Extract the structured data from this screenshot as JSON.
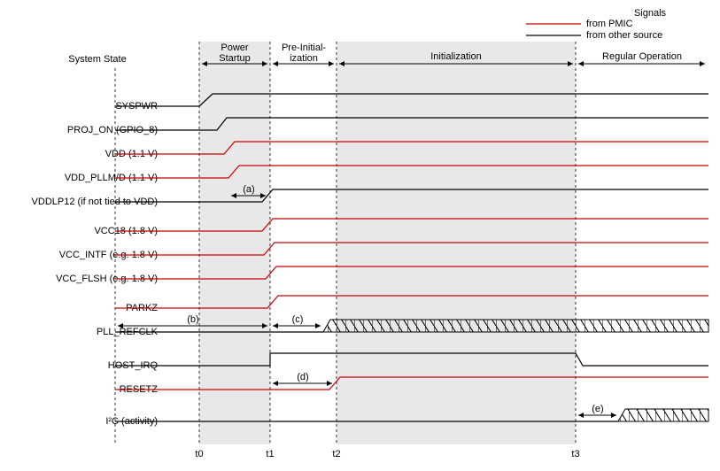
{
  "legend": {
    "title": "Signals",
    "items": [
      {
        "label": "from PMIC",
        "color": "#cc0000"
      },
      {
        "label": "from other source",
        "color": "#000000"
      }
    ]
  },
  "header": {
    "system_state": "System State"
  },
  "phases": {
    "power_startup_l1": "Power",
    "power_startup_l2": "Startup",
    "pre_init_l1": "Pre-Initial-",
    "pre_init_l2": "ization",
    "initialization": "Initialization",
    "regular_operation": "Regular Operation"
  },
  "signals": {
    "syspwr": "SYSPWR",
    "proj_on": "PROJ_ON (GPIO_8)",
    "vdd": "VDD (1.1 V)",
    "vdd_pll": "VDD_PLLM/D (1.1 V)",
    "vddlp12": "VDDLP12 (if not tied to VDD)",
    "vcc18": "VCC18 (1.8 V)",
    "vcc_intf": "VCC_INTF (e.g. 1.8 V)",
    "vcc_flsh": "VCC_FLSH (e.g. 1.8 V)",
    "parkz": "PARKZ",
    "pll_refclk": "PLL_REFCLK",
    "host_irq": "HOST_IRQ",
    "resetz": "RESETZ",
    "i2c": "I²C (activity)"
  },
  "markers": {
    "a": "(a)",
    "b": "(b)",
    "c": "(c)",
    "d": "(d)",
    "e": "(e)"
  },
  "time_labels": {
    "t0": "t0",
    "t1": "t1",
    "t2": "t2",
    "t3": "t3"
  }
}
